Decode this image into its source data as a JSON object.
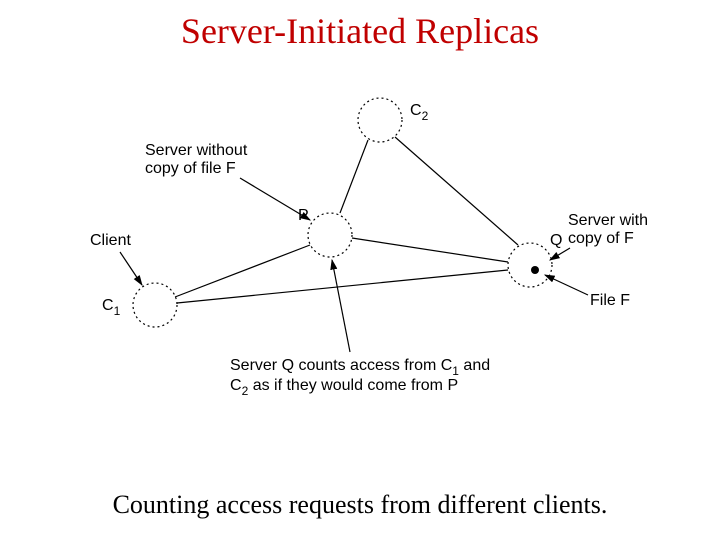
{
  "title": "Server-Initiated Replicas",
  "caption": "Counting access requests from different clients.",
  "labels": {
    "c2": "C",
    "c2_sub": "2",
    "server_without_l1": "Server without",
    "server_without_l2": "copy of file F",
    "p": "P",
    "client": "Client",
    "q": "Q",
    "server_with_l1": "Server with",
    "server_with_l2": "copy of F",
    "c1": "C",
    "c1_sub": "1",
    "file_f": "File F",
    "bottom_l1_a": "Server Q counts access from C",
    "bottom_l1_sub": "1",
    "bottom_l1_b": " and",
    "bottom_l2_a": "C",
    "bottom_l2_sub": "2",
    "bottom_l2_b": " as if they would come from P"
  }
}
